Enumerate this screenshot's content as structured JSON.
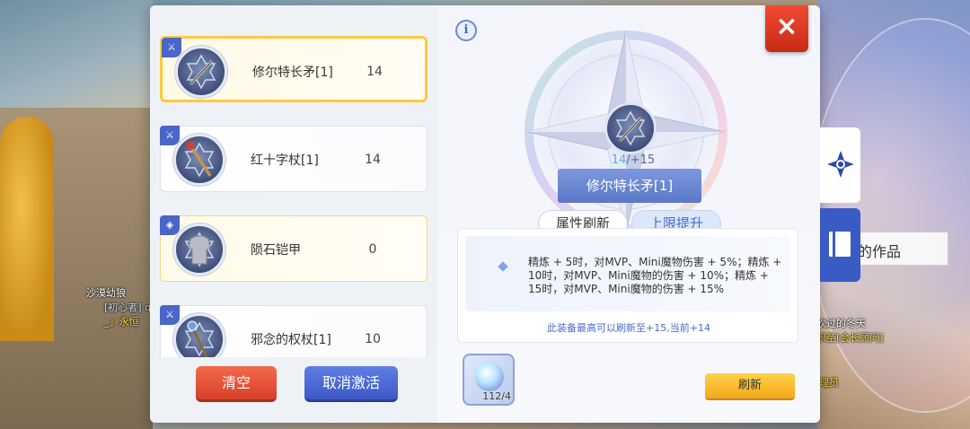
{
  "background": {
    "labels": [
      {
        "text": "沙漠幼狼",
        "cls": ""
      },
      {
        "text": "[初心者] q",
        "cls": ""
      },
      {
        "text": "_」永恒",
        "cls": "yellow"
      },
      {
        "text": "疯吹过的冬天",
        "cls": ""
      },
      {
        "text": "公职圣[会长顾问]",
        "cls": "yellow"
      },
      {
        "text": "理员",
        "cls": "yellow"
      },
      {
        "text": "的作品",
        "cls": ""
      }
    ]
  },
  "equipment_list": {
    "items": [
      {
        "name": "修尔特长矛[1]",
        "value": "14",
        "state": "selected",
        "badge": "weapon-icon"
      },
      {
        "name": "红十字杖[1]",
        "value": "14",
        "state": "normal",
        "badge": "weapon-icon"
      },
      {
        "name": "陨石铠甲",
        "value": "0",
        "state": "gold",
        "badge": "armor-icon"
      },
      {
        "name": "邪念的权杖[1]",
        "value": "10",
        "state": "normal",
        "badge": "weapon-icon"
      }
    ]
  },
  "buttons": {
    "clear": "清空",
    "cancel_activate": "取消激活",
    "refresh": "刷新",
    "close": "×",
    "info": "i"
  },
  "detail": {
    "level_current": "14",
    "level_max": "/+15",
    "item_name": "修尔特长矛[1]",
    "tabs": [
      "属性刷新",
      "上限提升"
    ],
    "active_tab": "上限提升",
    "description": "精炼 + 5时，对MVP、Mini魔物伤害 + 5%；精炼 + 10时，对MVP、Mini魔物的伤害 + 10%；精炼 + 15时，对MVP、Mini魔物的伤害 + 15%",
    "note": "此装备最高可以刷新至+15,当前+14",
    "material_count": "112/4"
  },
  "colors": {
    "accent_blue": "#4a66c8",
    "close_red": "#d8402c",
    "refresh_gold": "#f4a71a"
  }
}
